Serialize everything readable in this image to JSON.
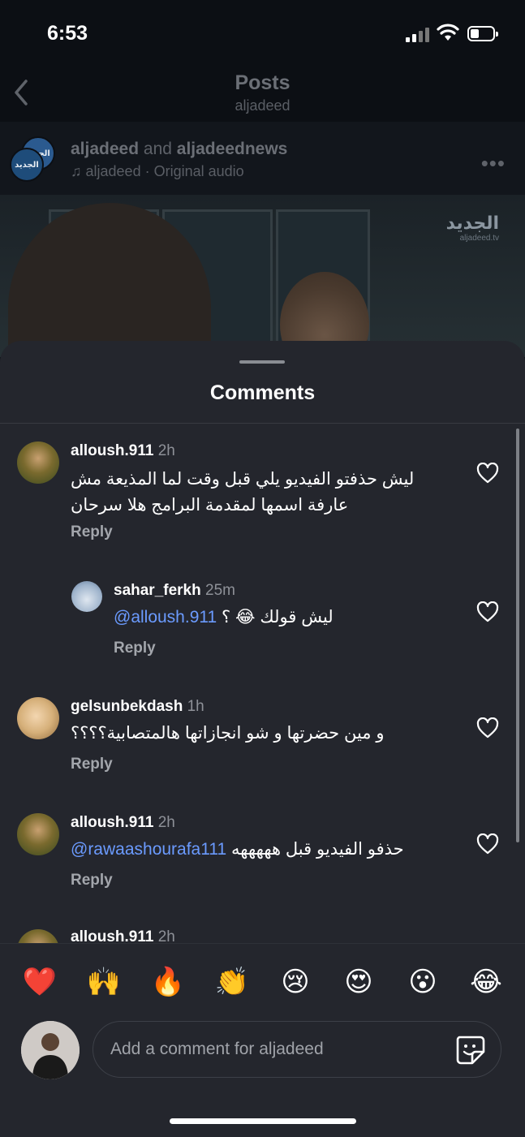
{
  "status": {
    "time": "6:53"
  },
  "header": {
    "title": "Posts",
    "subtitle": "aljadeed"
  },
  "post": {
    "author1": "aljadeed",
    "joiner": "and",
    "author2": "aljadeednews",
    "audio": "aljadeed · Original audio",
    "avatar_text": "الجديد",
    "logo_text": "الجديد",
    "logo_sub": "aljadeed.tv"
  },
  "comments_sheet": {
    "title": "Comments",
    "comments": [
      {
        "user": "alloush.911",
        "time": "2h",
        "text_line1": "ليش حذفتو الفيديو يلي قبل وقت لما المذيعة مش",
        "text_line2": "عارفة اسمها لمقدمة البرامج هلا سرحان",
        "reply": "Reply"
      },
      {
        "user": "sahar_ferkh",
        "time": "25m",
        "mention": "@alloush.911",
        "text": "ليش قولك 😂 ؟",
        "reply": "Reply"
      },
      {
        "user": "gelsunbekdash",
        "time": "1h",
        "text": "و مين حضرتها  و شو انجازاتها هالمتصابية؟؟؟؟",
        "reply": "Reply"
      },
      {
        "user": "alloush.911",
        "time": "2h",
        "mention": "@rawaashourafa111",
        "text": "حذفو الفيديو قبل  هههههه",
        "reply": "Reply"
      },
      {
        "user": "alloush.911",
        "time": "2h"
      }
    ]
  },
  "emoji_bar": [
    "❤️",
    "🙌",
    "🔥",
    "👏",
    "😢",
    "😍",
    "😮",
    "😂"
  ],
  "composer": {
    "placeholder": "Add a comment for aljadeed"
  }
}
